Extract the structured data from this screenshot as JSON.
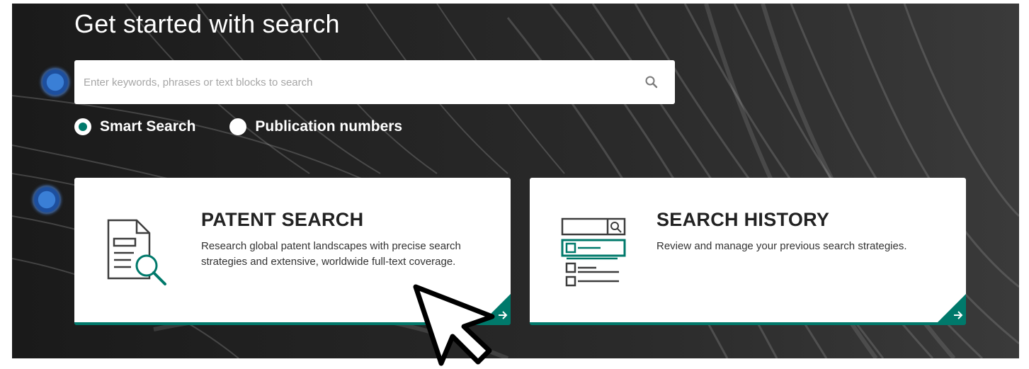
{
  "page": {
    "title": "Get started with search"
  },
  "search": {
    "placeholder": "Enter keywords, phrases or text blocks to search",
    "value": "",
    "icon": "search-icon"
  },
  "search_mode": {
    "options": [
      {
        "label": "Smart Search",
        "selected": true
      },
      {
        "label": "Publication numbers",
        "selected": false
      }
    ]
  },
  "cards": [
    {
      "title": "PATENT SEARCH",
      "description": "Research global patent landscapes with precise search strategies and extensive, worldwide full-text coverage.",
      "icon": "document-magnifier-icon"
    },
    {
      "title": "SEARCH HISTORY",
      "description": "Review and manage your previous search strategies.",
      "icon": "search-history-list-icon"
    }
  ],
  "colors": {
    "accent": "#00796b",
    "background": "#0c0c0c",
    "card": "#ffffff",
    "marker": "#3a7fd6"
  }
}
